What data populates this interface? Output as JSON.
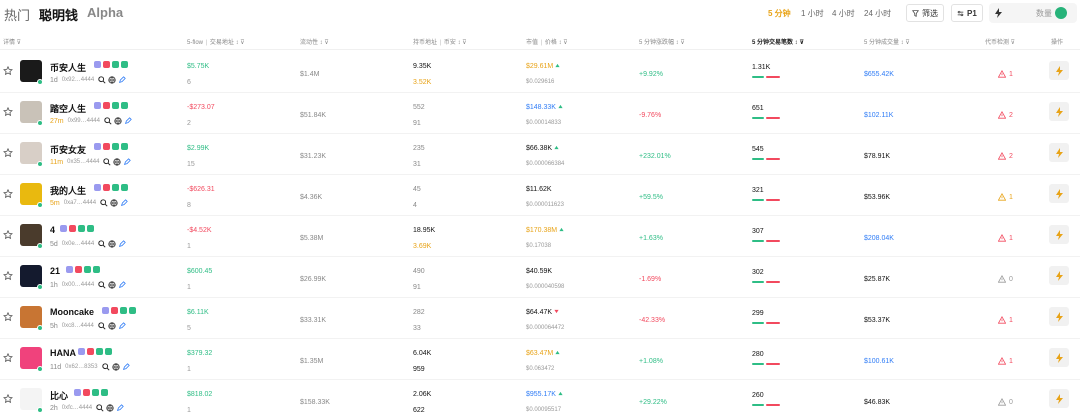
{
  "tabs": [
    {
      "label": "热门"
    },
    {
      "label": "聪明钱"
    },
    {
      "label": "Alpha"
    }
  ],
  "timeframes": [
    "5 分钟",
    "1 小时",
    "4 小时",
    "24 小时"
  ],
  "filter_label": "筛选",
  "p1_label": "P1",
  "qty_placeholder": "数量",
  "headers": {
    "detail": "详情",
    "flow": "5-flow",
    "flow_sub": "交易地址",
    "liquidity": "流动性",
    "holders": "持币地址",
    "holders_sub": "币安",
    "mcap": "市值",
    "mcap_sub": "价格",
    "change": "5 分钟涨跌幅",
    "txcount": "5 分钟交易笔数",
    "volume": "5 分钟成交量",
    "detection": "代币检测",
    "action": "操作"
  },
  "accent": "#e8a317",
  "rows": [
    {
      "name": "币安人生",
      "age": "1d",
      "addr": "0x92…4444",
      "flow": "$5.75K",
      "flow_color": "green",
      "flow_sub": "6",
      "liq": "$1.4M",
      "h1": "9.35K",
      "h1_color": "black",
      "h2": "3.52K",
      "h2_color": "orange",
      "mc": "$29.61M",
      "mc_color": "orange",
      "mc_arrow": "up",
      "price": "$0.029616",
      "chg": "+9.92%",
      "chg_color": "green",
      "tx": "1.31K",
      "vol": "$655.42K",
      "vol_color": "blue",
      "det": "1",
      "det_color": "red",
      "avatar": "#1a1a1a",
      "age_orange": false
    },
    {
      "name": "踏空人生",
      "age": "27m",
      "addr": "0x99…4444",
      "flow": "-$273.07",
      "flow_color": "red",
      "flow_sub": "2",
      "liq": "$51.84K",
      "h1": "552",
      "h1_color": "gray",
      "h2": "91",
      "h2_color": "gray",
      "mc": "$148.33K",
      "mc_color": "blue",
      "mc_arrow": "up",
      "price": "$0.00014833",
      "chg": "-9.76%",
      "chg_color": "red",
      "tx": "651",
      "vol": "$102.11K",
      "vol_color": "blue",
      "det": "2",
      "det_color": "red",
      "avatar": "#c9c2b8",
      "age_orange": true
    },
    {
      "name": "币安女友",
      "age": "11m",
      "addr": "0x35…4444",
      "flow": "$2.99K",
      "flow_color": "green",
      "flow_sub": "15",
      "liq": "$31.23K",
      "h1": "235",
      "h1_color": "gray",
      "h2": "31",
      "h2_color": "gray",
      "mc": "$66.38K",
      "mc_color": "black",
      "mc_arrow": "up",
      "price": "$0.000066384",
      "chg": "+232.01%",
      "chg_color": "green",
      "tx": "545",
      "vol": "$78.91K",
      "vol_color": "black",
      "det": "2",
      "det_color": "red",
      "avatar": "#d8cfc7",
      "age_orange": true
    },
    {
      "name": "我的人生",
      "age": "5m",
      "addr": "0xa7…4444",
      "flow": "-$626.31",
      "flow_color": "red",
      "flow_sub": "8",
      "liq": "$4.36K",
      "h1": "45",
      "h1_color": "gray",
      "h2": "4",
      "h2_color": "gray",
      "mc": "$11.62K",
      "mc_color": "black",
      "mc_arrow": "",
      "price": "$0.000011623",
      "chg": "+59.5%",
      "chg_color": "green",
      "tx": "321",
      "vol": "$53.96K",
      "vol_color": "black",
      "det": "1",
      "det_color": "orange",
      "avatar": "#e9b90f",
      "age_orange": true
    },
    {
      "name": "4",
      "age": "5d",
      "addr": "0x0e…4444",
      "flow": "-$4.52K",
      "flow_color": "red",
      "flow_sub": "1",
      "liq": "$5.38M",
      "h1": "18.95K",
      "h1_color": "black",
      "h2": "3.69K",
      "h2_color": "orange",
      "mc": "$170.38M",
      "mc_color": "orange",
      "mc_arrow": "up",
      "price": "$0.17038",
      "chg": "+1.63%",
      "chg_color": "green",
      "tx": "307",
      "vol": "$208.04K",
      "vol_color": "blue",
      "det": "1",
      "det_color": "red",
      "avatar": "#4a3b2c",
      "age_orange": false
    },
    {
      "name": "21",
      "age": "1h",
      "addr": "0x00…4444",
      "flow": "$600.45",
      "flow_color": "green",
      "flow_sub": "1",
      "liq": "$26.99K",
      "h1": "490",
      "h1_color": "gray",
      "h2": "91",
      "h2_color": "gray",
      "mc": "$40.59K",
      "mc_color": "black",
      "mc_arrow": "",
      "price": "$0.000040598",
      "chg": "-1.69%",
      "chg_color": "red",
      "tx": "302",
      "vol": "$25.87K",
      "vol_color": "black",
      "det": "0",
      "det_color": "gray",
      "avatar": "#141a2e",
      "age_orange": false
    },
    {
      "name": "Mooncake",
      "age": "5h",
      "addr": "0xc8…4444",
      "flow": "$6.11K",
      "flow_color": "green",
      "flow_sub": "5",
      "liq": "$33.31K",
      "h1": "282",
      "h1_color": "gray",
      "h2": "33",
      "h2_color": "gray",
      "mc": "$64.47K",
      "mc_color": "black",
      "mc_arrow": "down",
      "price": "$0.000064472",
      "chg": "-42.33%",
      "chg_color": "red",
      "tx": "299",
      "vol": "$53.37K",
      "vol_color": "black",
      "det": "1",
      "det_color": "red",
      "avatar": "#c87533",
      "age_orange": false
    },
    {
      "name": "HANA",
      "age": "11d",
      "addr": "0x62…8353",
      "flow": "$379.32",
      "flow_color": "green",
      "flow_sub": "1",
      "liq": "$1.35M",
      "h1": "6.04K",
      "h1_color": "black",
      "h2": "959",
      "h2_color": "black",
      "mc": "$63.47M",
      "mc_color": "orange",
      "mc_arrow": "up",
      "price": "$0.063472",
      "chg": "+1.08%",
      "chg_color": "green",
      "tx": "280",
      "vol": "$100.61K",
      "vol_color": "blue",
      "det": "1",
      "det_color": "red",
      "avatar": "#f0427c",
      "age_orange": false
    },
    {
      "name": "比心",
      "age": "2h",
      "addr": "0xfc…4444",
      "flow": "$818.02",
      "flow_color": "green",
      "flow_sub": "1",
      "liq": "$158.33K",
      "h1": "2.06K",
      "h1_color": "black",
      "h2": "622",
      "h2_color": "black",
      "mc": "$955.17K",
      "mc_color": "blue",
      "mc_arrow": "up",
      "price": "$0.00095517",
      "chg": "+29.22%",
      "chg_color": "green",
      "tx": "260",
      "vol": "$46.83K",
      "vol_color": "black",
      "det": "0",
      "det_color": "gray",
      "avatar": "#f4f4f4",
      "age_orange": false
    }
  ]
}
